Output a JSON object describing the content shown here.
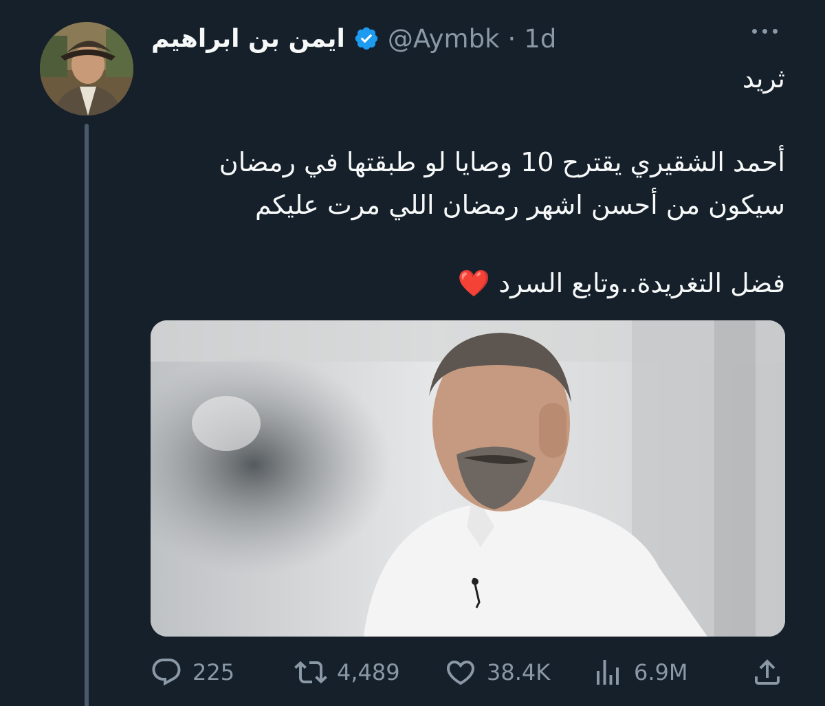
{
  "author": {
    "display_name": "ايمن بن ابراهيم",
    "handle": "@Aymbk",
    "separator": "·",
    "time": "1d",
    "verified": true,
    "verified_color": "#1d9bf0"
  },
  "tweet": {
    "line_1": "ثريد",
    "line_2": "أحمد الشقيري يقترح 10 وصايا لو طبقتها في رمضان",
    "line_3": "سيكون من أحسن اشهر رمضان اللي مرت عليكم",
    "line_4": "فضل التغريدة..وتابع السرد",
    "emoji": "❤️"
  },
  "actions": {
    "replies": "225",
    "retweets": "4,489",
    "likes": "38.4K",
    "views": "6.9M"
  },
  "icons": [
    "avatar",
    "verified-badge-icon",
    "more-icon",
    "reply-icon",
    "retweet-icon",
    "like-icon",
    "views-icon",
    "share-icon"
  ],
  "colors": {
    "background": "#15202b",
    "text": "#f7f9f9",
    "muted": "#8b98a5",
    "heart": "#e0245e"
  }
}
